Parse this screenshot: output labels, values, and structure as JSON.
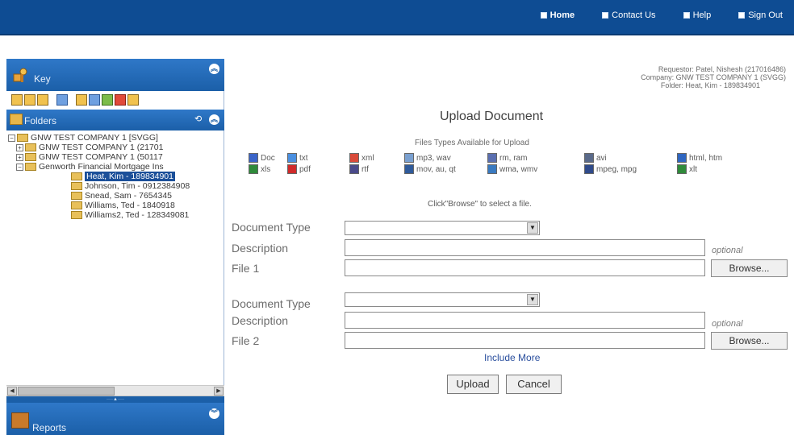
{
  "nav": {
    "items": [
      {
        "label": "Home"
      },
      {
        "label": "Contact Us"
      },
      {
        "label": "Help"
      },
      {
        "label": "Sign Out"
      }
    ]
  },
  "left": {
    "key_title": "Key",
    "folders_title": "Folders",
    "reports_title": "Reports",
    "tree": [
      {
        "label": "GNW TEST COMPANY 1 [SVGG]"
      },
      {
        "label": "GNW TEST COMPANY 1 (21701"
      },
      {
        "label": "GNW TEST COMPANY 1 (50117"
      },
      {
        "label": "Genworth Financial Mortgage Ins"
      },
      {
        "label": "Heat, Kim - 189834901"
      },
      {
        "label": "Johnson, Tim - 0912384908"
      },
      {
        "label": "Snead, Sam - 7654345"
      },
      {
        "label": "Williams, Ted - 1840918"
      },
      {
        "label": "Williams2, Ted - 128349081"
      }
    ]
  },
  "requester": {
    "line1": "Requestor: Patel, Nishesh (217016486)",
    "line2": "Company: GNW TEST COMPANY 1 (SVGG)",
    "line3": "Folder: Heat, Kim - 189834901"
  },
  "main": {
    "title": "Upload Document",
    "filetypes_title": "Files Types Available for Upload",
    "filetypes": [
      {
        "label": "Doc",
        "color": "#3a64c8"
      },
      {
        "label": "txt",
        "color": "#4a8fe0"
      },
      {
        "label": "xml",
        "color": "#d94a3a"
      },
      {
        "label": "mp3, wav",
        "color": "#7aa0d0"
      },
      {
        "label": "rm, ram",
        "color": "#5b6fb0"
      },
      {
        "label": "avi",
        "color": "#5a6a8a"
      },
      {
        "label": "html, htm",
        "color": "#2f66c0"
      },
      {
        "label": "xls",
        "color": "#2f8a3a"
      },
      {
        "label": "pdf",
        "color": "#d02a2a"
      },
      {
        "label": "rtf",
        "color": "#4a4a8a"
      },
      {
        "label": "mov, au, qt",
        "color": "#2f5a9a"
      },
      {
        "label": "wma, wmv",
        "color": "#3a7ac0"
      },
      {
        "label": "mpeg, mpg",
        "color": "#2f4a8a"
      },
      {
        "label": "xlt",
        "color": "#2f8a3a"
      }
    ],
    "click_hint": "Click\"Browse\" to select a file.",
    "doc_type_label": "Document Type",
    "description_label": "Description",
    "optional_label": "optional",
    "file1_label": "File 1",
    "file2_label": "File 2",
    "browse_label": "Browse...",
    "include_more": "Include More",
    "upload_label": "Upload",
    "cancel_label": "Cancel"
  }
}
